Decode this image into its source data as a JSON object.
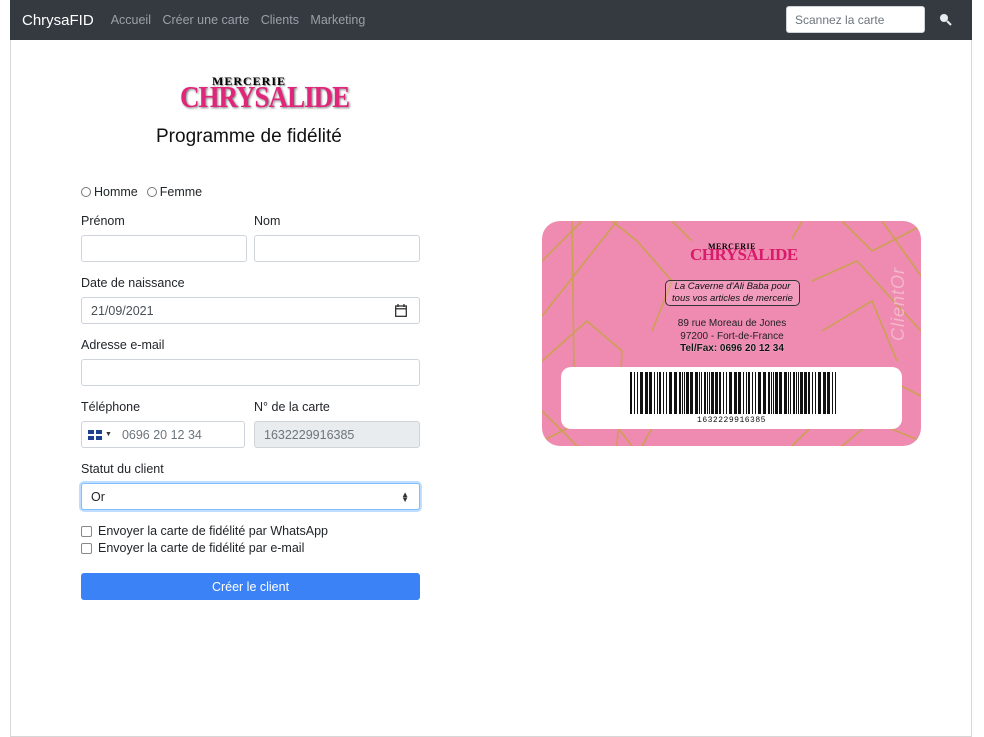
{
  "navbar": {
    "brand": "ChrysaFID",
    "links": [
      "Accueil",
      "Créer une carte",
      "Clients",
      "Marketing"
    ],
    "search_placeholder": "Scannez la carte"
  },
  "logo": {
    "small": "MERCERIE",
    "big": "CHRYSALIDE"
  },
  "page_title": "Programme de fidélité",
  "form": {
    "gender_options": [
      "Homme",
      "Femme"
    ],
    "firstname_label": "Prénom",
    "lastname_label": "Nom",
    "firstname_value": "",
    "lastname_value": "",
    "birthdate_label": "Date de naissance",
    "birthdate_value": "21/09/2021",
    "email_label": "Adresse e-mail",
    "email_value": "",
    "phone_label": "Téléphone",
    "phone_placeholder": "0696 20 12 34",
    "card_number_label": "N° de la carte",
    "card_number_value": "1632229916385",
    "status_label": "Statut du client",
    "status_value": "Or",
    "whatsapp_label": "Envoyer la carte de fidélité par WhatsApp",
    "email_send_label": "Envoyer la carte de fidélité par e-mail",
    "submit_label": "Créer le client"
  },
  "card": {
    "logo_small": "MERCERIE",
    "logo_big": "CHRYSALIDE",
    "slogan_line1": "La Caverne d'Ali Baba pour",
    "slogan_line2": "tous vos articles de mercerie",
    "address_line1": "89 rue Moreau de Jones",
    "address_line2": "97200 - Fort-de-France",
    "tel_line": "Tel/Fax: 0696 20 12 34",
    "vertical_label": "ClientOr",
    "barcode_number": "1632229916385",
    "colors": {
      "background": "#ef8bb1",
      "lines": "#c9a24a",
      "brand": "#d81b6a"
    }
  },
  "colors": {
    "navbar": "#343a40",
    "primary": "#3b82f6",
    "brand_pink": "#e0267a"
  }
}
